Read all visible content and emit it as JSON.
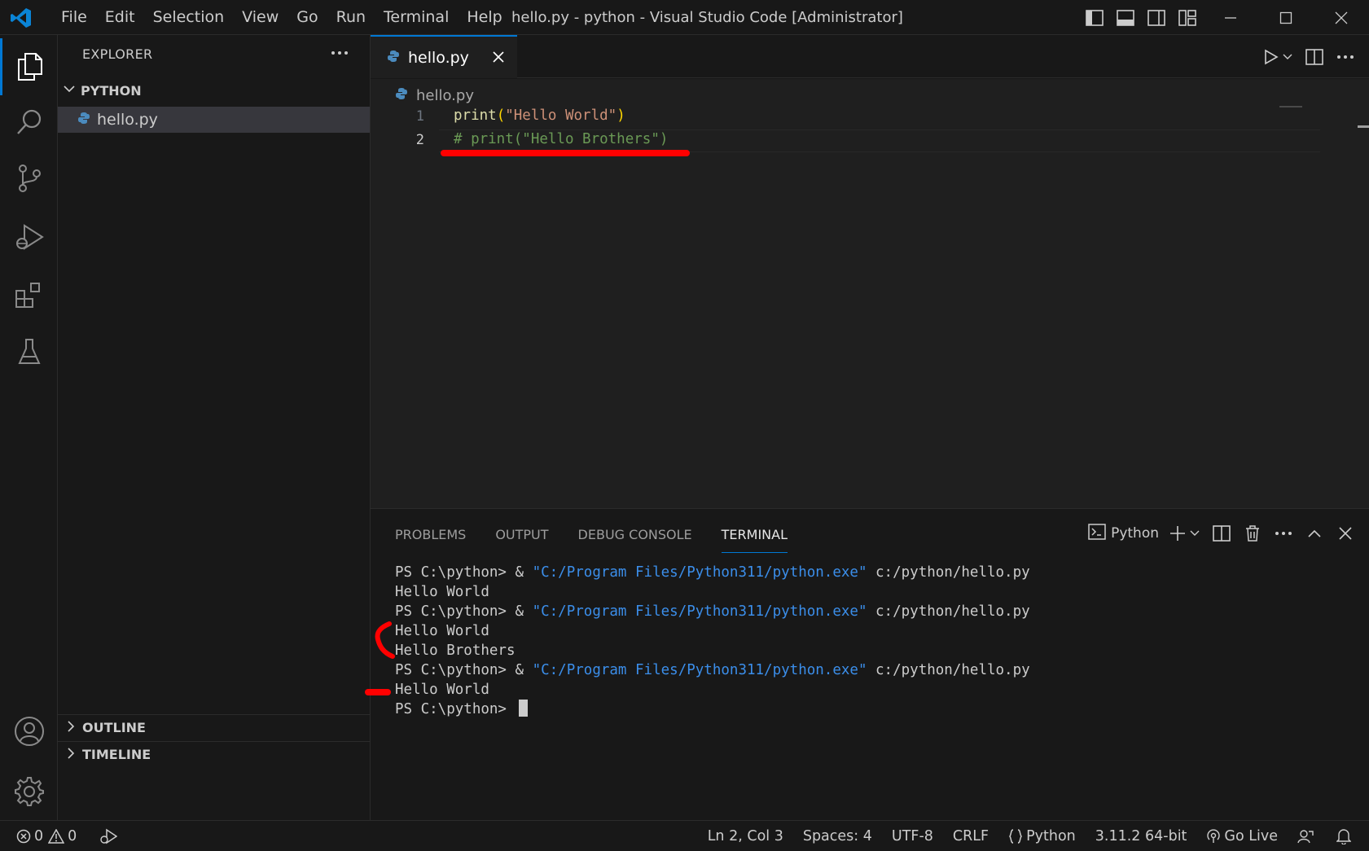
{
  "titlebar": {
    "menu": [
      "File",
      "Edit",
      "Selection",
      "View",
      "Go",
      "Run",
      "Terminal",
      "Help"
    ],
    "window_title": "hello.py - python - Visual Studio Code [Administrator]"
  },
  "sidebar": {
    "title": "EXPLORER",
    "folder": "PYTHON",
    "files": [
      "hello.py"
    ],
    "sections": [
      "OUTLINE",
      "TIMELINE"
    ]
  },
  "editor": {
    "tab_label": "hello.py",
    "breadcrumb": "hello.py",
    "lines": [
      {
        "num": "1",
        "fn": "print",
        "open": "(",
        "str": "\"Hello World\"",
        "close": ")"
      },
      {
        "num": "2",
        "comment": "# print(\"Hello Brothers\")"
      }
    ]
  },
  "panel": {
    "tabs": [
      "PROBLEMS",
      "OUTPUT",
      "DEBUG CONSOLE",
      "TERMINAL"
    ],
    "active_tab": "TERMINAL",
    "shell_label": "Python",
    "terminal": {
      "prompt": "PS C:\\python> & ",
      "exe": "\"C:/Program Files/Python311/python.exe\"",
      "script": " c:/python/hello.py",
      "output_1": "Hello World",
      "output_2a": "Hello World",
      "output_2b": "Hello Brothers",
      "output_3": "Hello World",
      "final_prompt": "PS C:\\python> "
    }
  },
  "statusbar": {
    "errors": "0",
    "warnings": "0",
    "position": "Ln 2, Col 3",
    "spaces": "Spaces: 4",
    "encoding": "UTF-8",
    "eol": "CRLF",
    "language": "Python",
    "interpreter": "3.11.2 64-bit",
    "go_live": "Go Live"
  },
  "colors": {
    "accent": "#0078d4",
    "annotation_red": "#ff0000",
    "string": "#ce9178",
    "function": "#dcdcaa",
    "comment": "#6a9955",
    "terminal_path": "#3b8eea"
  }
}
